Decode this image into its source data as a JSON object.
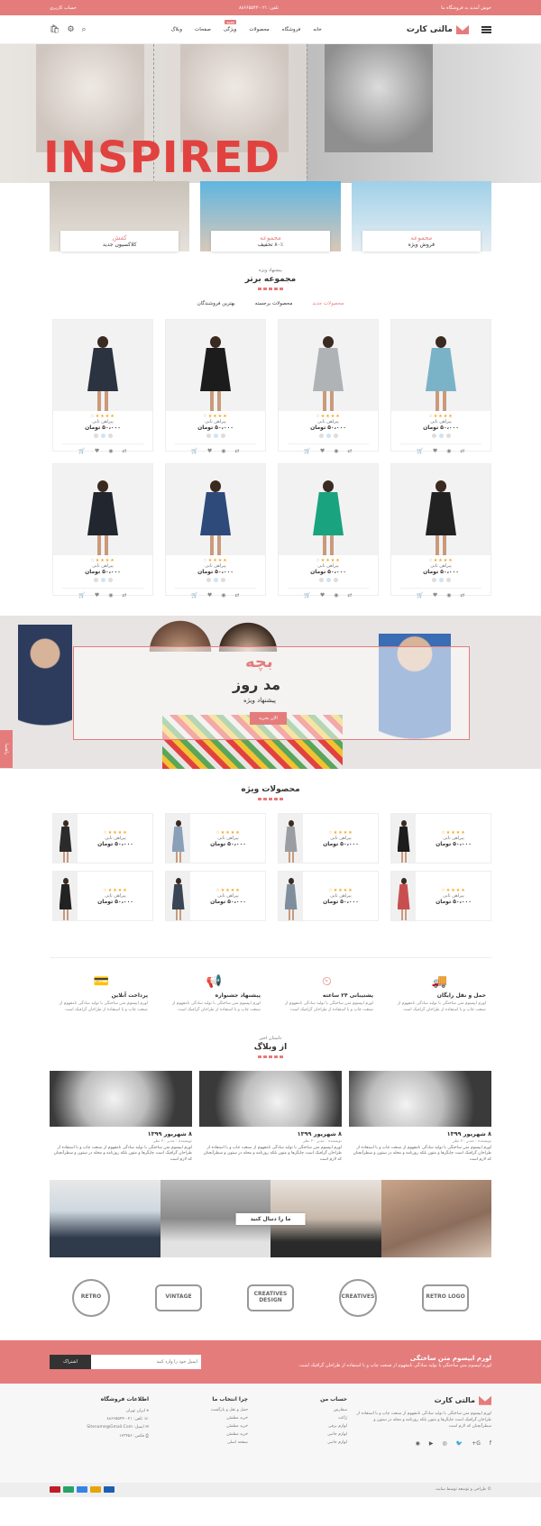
{
  "topbar": {
    "welcome": "خوش آمدید به فروشگاه ما",
    "phone": "تلفن: ۰۲۱-۸۸۶۶۵۵۴۴",
    "account": "حساب کاربری"
  },
  "header": {
    "logo": "مالتی کارت",
    "nav": [
      "خانه",
      "فروشگاه",
      "محصولات",
      "ویژگی",
      "صفحات",
      "وبلاگ"
    ],
    "nav_badge": "جدید"
  },
  "hero": {
    "headline": "INSPIRED"
  },
  "categories": [
    {
      "title": "مجموعه",
      "sub": "فروش ویژه"
    },
    {
      "title": "مجموعه",
      "sub": "۸۰٪ تخفیف"
    },
    {
      "title": "کفش",
      "sub": "کلاکسیون جدید"
    }
  ],
  "top_collection": {
    "kicker": "پیشنهاد ویژه",
    "title": "مجموعه برتر",
    "tabs": [
      "محصولات جدید",
      "محصولات برجسته",
      "بهترین فروشندگان"
    ],
    "products": [
      {
        "name": "پیراهن تابی",
        "price": "۵۰،۰۰۰ تومان",
        "dress": "#7ab3c8"
      },
      {
        "name": "پیراهن تابی",
        "price": "۵۰،۰۰۰ تومان",
        "dress": "#b0b3b5"
      },
      {
        "name": "پیراهن تابی",
        "price": "۵۰،۰۰۰ تومان",
        "dress": "#1c1c1c"
      },
      {
        "name": "پیراهن تابی",
        "price": "۵۰،۰۰۰ تومان",
        "dress": "#2b3240"
      },
      {
        "name": "پیراهن تابی",
        "price": "۵۰،۰۰۰ تومان",
        "dress": "#222222"
      },
      {
        "name": "پیراهن تابی",
        "price": "۵۰،۰۰۰ تومان",
        "dress": "#1aa37f"
      },
      {
        "name": "پیراهن تابی",
        "price": "۵۰،۰۰۰ تومان",
        "dress": "#2d4a7a"
      },
      {
        "name": "پیراهن تابی",
        "price": "۵۰،۰۰۰ تومان",
        "dress": "#22262e"
      }
    ],
    "stars": "★★★★☆"
  },
  "kids_banner": {
    "title": "بچه",
    "subtitle": "مد روز",
    "offer": "پیشنهاد ویژه",
    "button": "الان بخرید"
  },
  "side_tab": "راهنما",
  "featured": {
    "title": "محصولات ویژه",
    "products": [
      {
        "name": "پیراهن تابی",
        "price": "۵۰،۰۰۰ تومان",
        "dress": "#1d1d1d"
      },
      {
        "name": "پیراهن تابی",
        "price": "۵۰،۰۰۰ تومان",
        "dress": "#9a9ea2"
      },
      {
        "name": "پیراهن تابی",
        "price": "۵۰،۰۰۰ تومان",
        "dress": "#8aa0b8"
      },
      {
        "name": "پیراهن تابی",
        "price": "۵۰،۰۰۰ تومان",
        "dress": "#2b2b2b"
      },
      {
        "name": "پیراهن تابی",
        "price": "۵۰،۰۰۰ تومان",
        "dress": "#c94f4f"
      },
      {
        "name": "پیراهن تابی",
        "price": "۵۰،۰۰۰ تومان",
        "dress": "#7e8e9c"
      },
      {
        "name": "پیراهن تابی",
        "price": "۵۰،۰۰۰ تومان",
        "dress": "#3a4556"
      },
      {
        "name": "پیراهن تابی",
        "price": "۵۰،۰۰۰ تومان",
        "dress": "#222222"
      }
    ]
  },
  "services": [
    {
      "title": "حمل و نقل رایگان",
      "text": "لورم ایپسوم متن ساختگی با تولید سادگی نامفهوم از صنعت چاپ و با استفاده از طراحان گرافیک است"
    },
    {
      "title": "پشتیبانی ۲۴ ساعته",
      "text": "لورم ایپسوم متن ساختگی با تولید سادگی نامفهوم از صنعت چاپ و با استفاده از طراحان گرافیک است"
    },
    {
      "title": "پیشنهاد جشنواره",
      "text": "لورم ایپسوم متن ساختگی با تولید سادگی نامفهوم از صنعت چاپ و با استفاده از طراحان گرافیک است"
    },
    {
      "title": "پرداخت آنلاین",
      "text": "لورم ایپسوم متن ساختگی با تولید سادگی نامفهوم از صنعت چاپ و با استفاده از طراحان گرافیک است"
    }
  ],
  "blog": {
    "kicker": "داستان اخیر",
    "title": "از وبلاگ",
    "posts": [
      {
        "date": "۸ شهریور ۱۳۹۹",
        "meta": "نویسنده : مدیر  ۲۰ نظر",
        "text": "لورم ایپسوم متن ساختگی با تولید سادگی نامفهوم از صنعت چاپ و با استفاده از طراحان گرافیک است چاپگرها و متون بلکه روزنامه و مجله در ستون و سطرآنچنان که لازم است"
      },
      {
        "date": "۸ شهریور ۱۳۹۹",
        "meta": "نویسنده : مدیر  ۲۰ نظر",
        "text": "لورم ایپسوم متن ساختگی با تولید سادگی نامفهوم از صنعت چاپ و با استفاده از طراحان گرافیک است چاپگرها و متون بلکه روزنامه و مجله در ستون و سطرآنچنان که لازم است"
      },
      {
        "date": "۸ شهریور ۱۳۹۹",
        "meta": "نویسنده : مدیر  ۲۰ نظر",
        "text": "لورم ایپسوم متن ساختگی با تولید سادگی نامفهوم از صنعت چاپ و با استفاده از طراحان گرافیک است چاپگرها و متون بلکه روزنامه و مجله در ستون و سطرآنچنان که لازم است"
      }
    ]
  },
  "instagram": {
    "follow": "ما را دنبال کنید"
  },
  "brands": [
    "RETRO LOGO",
    "CREATIVES",
    "CREATIVES DESIGN",
    "VINTAGE",
    "RETRO"
  ],
  "newsletter": {
    "title": "لورم ایپسوم متن ساختگی",
    "text": "لورم ایپسوم متن ساختگی با تولید سادگی نامفهوم از صنعت چاپ و با استفاده از طراحان گرافیک است.",
    "placeholder": "ایمیل خود را وارد کنید",
    "button": "اشتراک"
  },
  "footer": {
    "logo": "مالتی کارت",
    "about": "لورم ایپسوم متن ساختگی با تولید سادگی نامفهوم از صنعت چاپ و با استفاده از طراحان گرافیک است چاپگرها و متون بلکه روزنامه و مجله در ستون و سطرآنچنان که لازم است",
    "account_title": "حساب من",
    "account_links": [
      "سفارش",
      "ژاکت",
      "لوازم برقی",
      "لوازم جانبی",
      "لوازم جانبی"
    ],
    "why_title": "چرا انتخاب ما",
    "why_links": [
      "حمل و نقل و بازگشت",
      "خرید مطمئن",
      "خرید مطمئن",
      "خرید مطمئن",
      "صفحه اصلی"
    ],
    "info_title": "اطلاعات فروشگاه",
    "info": [
      "ایران تهران",
      "تلفن: ۰۲۱-۸۸۶۶۵۵۴۴",
      "ایمیل: Sitename@Gmail.Com",
      "فکس: ۱۲۳۴۵۶"
    ],
    "copyright": "© طراحی و توسعه توسط سایت"
  },
  "colors": {
    "accent": "#e57c7c",
    "hero_red": "#e2423f"
  }
}
